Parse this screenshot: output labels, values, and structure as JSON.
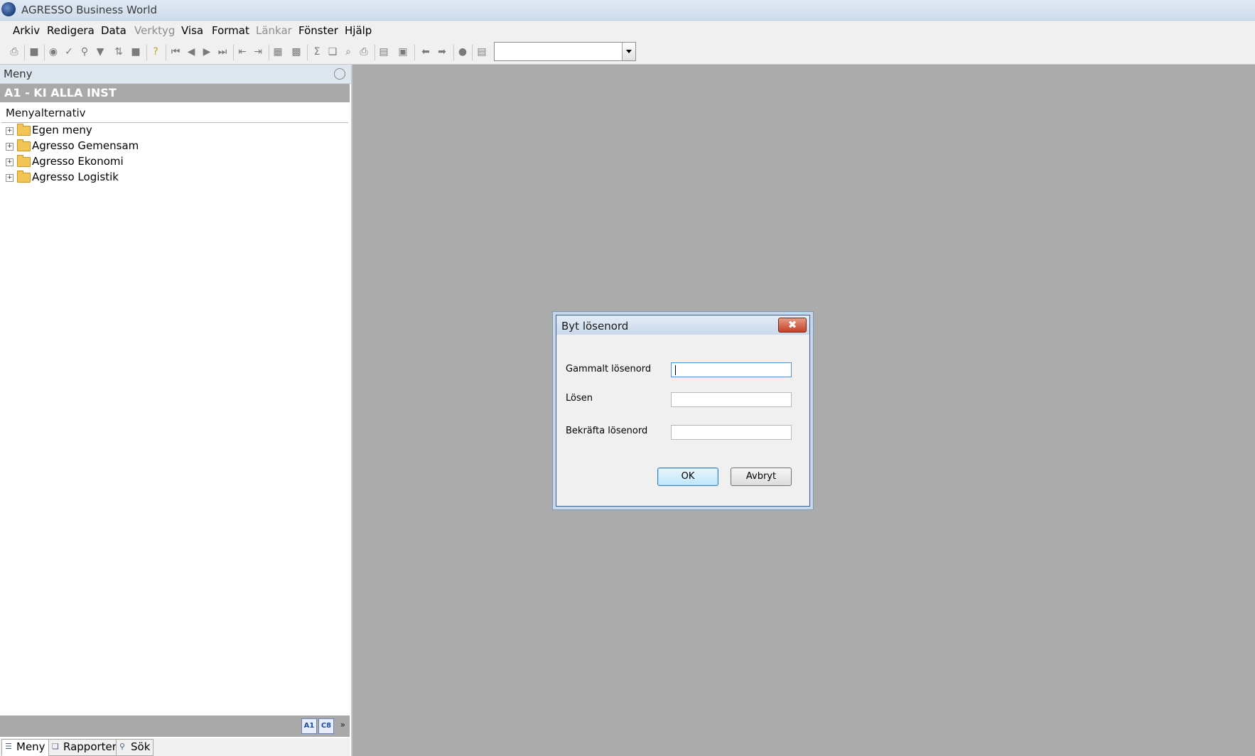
{
  "window": {
    "title": "AGRESSO Business World"
  },
  "menubar": {
    "items": [
      "Arkiv",
      "Redigera",
      "Data",
      "Verktyg",
      "Visa",
      "Format",
      "Länkar",
      "Fönster",
      "Hjälp"
    ]
  },
  "left_panel": {
    "header": "Meny",
    "company": "A1 - KI ALLA INST",
    "section": "Menyalternativ",
    "tree": [
      "Egen meny",
      "Agresso Gemensam",
      "Agresso Ekonomi",
      "Agresso Logistik"
    ],
    "mini_buttons": [
      "A1",
      "C8"
    ],
    "tabs": [
      "Meny",
      "Rapporter",
      "Sök"
    ]
  },
  "dialog": {
    "title": "Byt lösenord",
    "fields": [
      {
        "label": "Gammalt lösenord",
        "value": ""
      },
      {
        "label": "Lösen",
        "value": ""
      },
      {
        "label": "Bekräfta lösenord",
        "value": ""
      }
    ],
    "ok_label": "OK",
    "cancel_label": "Avbryt"
  },
  "icons": [
    "app-globe-icon",
    "print-icon",
    "save-icon",
    "binoculars-icon",
    "check-icon",
    "search-icon",
    "filter-icon",
    "sort-icon",
    "stop-icon",
    "help-icon",
    "first-record-icon",
    "prev-record-icon",
    "next-record-icon",
    "last-record-icon",
    "indent-icon",
    "outdent-icon",
    "grid-icon",
    "bar-chart-icon",
    "sum-icon",
    "copy-icon",
    "zoom-icon",
    "print-preview-icon",
    "folder-open-icon",
    "briefcase-icon",
    "back-arrow-icon",
    "forward-arrow-icon",
    "circle-icon",
    "document-icon"
  ]
}
